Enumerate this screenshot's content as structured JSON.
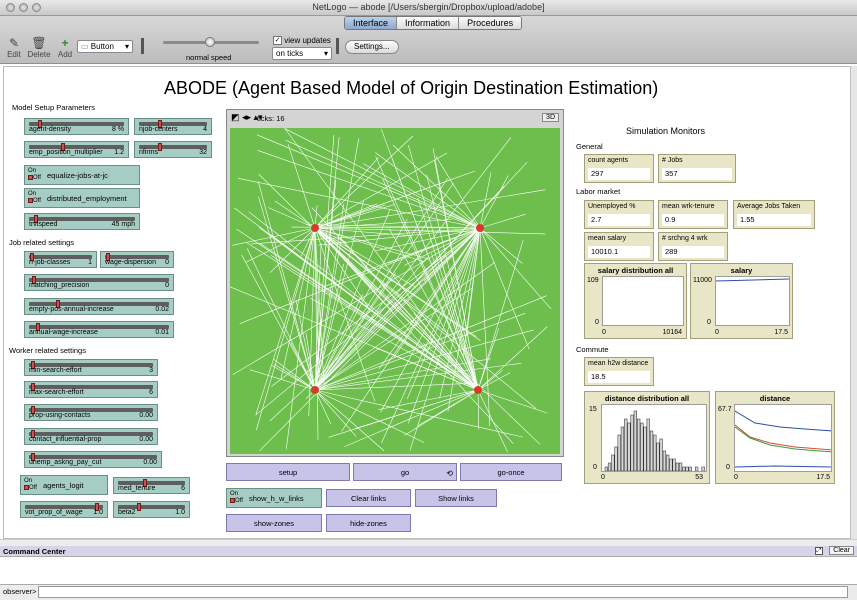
{
  "window": {
    "title": "NetLogo — abode [/Users/sbergin/Dropbox/upload/adobe]"
  },
  "tabs": [
    {
      "label": "Interface",
      "active": true
    },
    {
      "label": "Information",
      "active": false
    },
    {
      "label": "Procedures",
      "active": false
    }
  ],
  "toolbar": {
    "edit": "Edit",
    "delete": "Delete",
    "add": "Add",
    "widget_type": "Button",
    "speed_label": "normal speed",
    "view_updates": "view updates",
    "update_mode": "on ticks",
    "settings": "Settings..."
  },
  "model": {
    "title": "ABODE (Agent Based Model of Origin Destination Estimation)"
  },
  "sections": {
    "setup": "Model Setup Parameters",
    "job": "Job related settings",
    "worker": "Worker related settings",
    "monitors": "Simulation Monitors",
    "general": "General",
    "labor": "Labor market",
    "commute": "Commute"
  },
  "sliders": [
    {
      "id": "agent-density",
      "label": "agent-density",
      "value": "8 %",
      "frac": 0.1
    },
    {
      "id": "njob-centers",
      "label": "njob-centers",
      "value": "4",
      "frac": 0.3
    },
    {
      "id": "emp-position-multiplier",
      "label": "emp_position_multiplier",
      "value": "1.2",
      "frac": 0.35
    },
    {
      "id": "nfirms",
      "label": "nfirms",
      "value": "32",
      "frac": 0.3
    },
    {
      "id": "trvlspeed",
      "label": "trvlspeed",
      "value": "45 mph",
      "frac": 0.05
    },
    {
      "id": "n-job-classes",
      "label": "n-job-classes",
      "value": "1",
      "frac": 0.02
    },
    {
      "id": "wage-dispersion",
      "label": "wage-dispersion",
      "value": "0",
      "frac": 0.02
    },
    {
      "id": "matching-precision",
      "label": "matching_precision",
      "value": "0",
      "frac": 0.02
    },
    {
      "id": "empty-pos-annual-increase",
      "label": "empty-pos-annual-increase",
      "value": "0.02",
      "frac": 0.2
    },
    {
      "id": "annual-wage-increase",
      "label": "annual-wage-increase",
      "value": "0.01",
      "frac": 0.05
    },
    {
      "id": "min-search-effort",
      "label": "min-search-effort",
      "value": "3",
      "frac": 0.02
    },
    {
      "id": "max-search-effort",
      "label": "max-search-effort",
      "value": "6",
      "frac": 0.02
    },
    {
      "id": "prop-using-contacts",
      "label": "prop-using-contacts",
      "value": "0.00",
      "frac": 0.02
    },
    {
      "id": "contact-influential-prop",
      "label": "contact_influential-prop",
      "value": "0.00",
      "frac": 0.02
    },
    {
      "id": "unemp-askng-pay-cut",
      "label": "unemp_askng_pay_cut",
      "value": "0.00",
      "frac": 0.02
    },
    {
      "id": "med-tenure",
      "label": "med_tenure",
      "value": "6",
      "frac": 0.4
    },
    {
      "id": "vot-prop-of-wage",
      "label": "vot_prop_of_wage",
      "value": "1.0",
      "frac": 0.95
    },
    {
      "id": "beta2",
      "label": "beta2",
      "value": "1.0",
      "frac": 0.3
    }
  ],
  "switches": [
    {
      "id": "equalize-jobs-at-jc",
      "label": "equalize-jobs-at-jc"
    },
    {
      "id": "distributed-employment",
      "label": "distributed_employment"
    },
    {
      "id": "agents-logit",
      "label": "agents_logit"
    },
    {
      "id": "show-h-w-links",
      "label": "show_h_w_links"
    }
  ],
  "switch_state": {
    "on": "On",
    "off": "Off"
  },
  "buttons": {
    "setup": "setup",
    "go": "go",
    "go_once": "go-once",
    "clear_links": "Clear links",
    "show_links": "Show links",
    "show_zones": "show-zones",
    "hide_zones": "hide-zones",
    "forever": "⟲"
  },
  "view": {
    "ticks_label": "ticks: 16",
    "btn3d": "3D",
    "bg": "#6dbe4d",
    "link_color": "#ffffff",
    "node_color": "#d93a2b"
  },
  "monitors": {
    "count_agents": {
      "label": "count agents",
      "value": "297"
    },
    "jobs": {
      "label": "# Jobs",
      "value": "357"
    },
    "unemployed": {
      "label": "Unemployed %",
      "value": "2.7"
    },
    "mean_wrk_tenure": {
      "label": "mean wrk-tenure",
      "value": "0.9"
    },
    "avg_jobs_taken": {
      "label": "Average Jobs Taken",
      "value": "1.55"
    },
    "mean_salary": {
      "label": "mean salary",
      "value": "10010.1"
    },
    "srchng": {
      "label": "# srchng 4 wrk",
      "value": "289"
    },
    "mean_h2w": {
      "label": "mean h2w distance",
      "value": "18.5"
    }
  },
  "plots": {
    "salary_dist": {
      "title": "salary distribution all",
      "ymax": "109",
      "ymin": "0",
      "xmin": "0",
      "xmax": "10164"
    },
    "salary": {
      "title": "salary",
      "ymax": "11000",
      "ymin": "0",
      "xmin": "0",
      "xmax": "17.5"
    },
    "distance_dist": {
      "title": "distance distribution all",
      "ymax": "15",
      "ymin": "0",
      "xmin": "0",
      "xmax": "53"
    },
    "distance": {
      "title": "distance",
      "ymax": "67.7",
      "ymin": "0",
      "xmin": "0",
      "xmax": "17.5"
    }
  },
  "command_center": {
    "title": "Command Center",
    "clear": "Clear",
    "observer": "observer>"
  }
}
